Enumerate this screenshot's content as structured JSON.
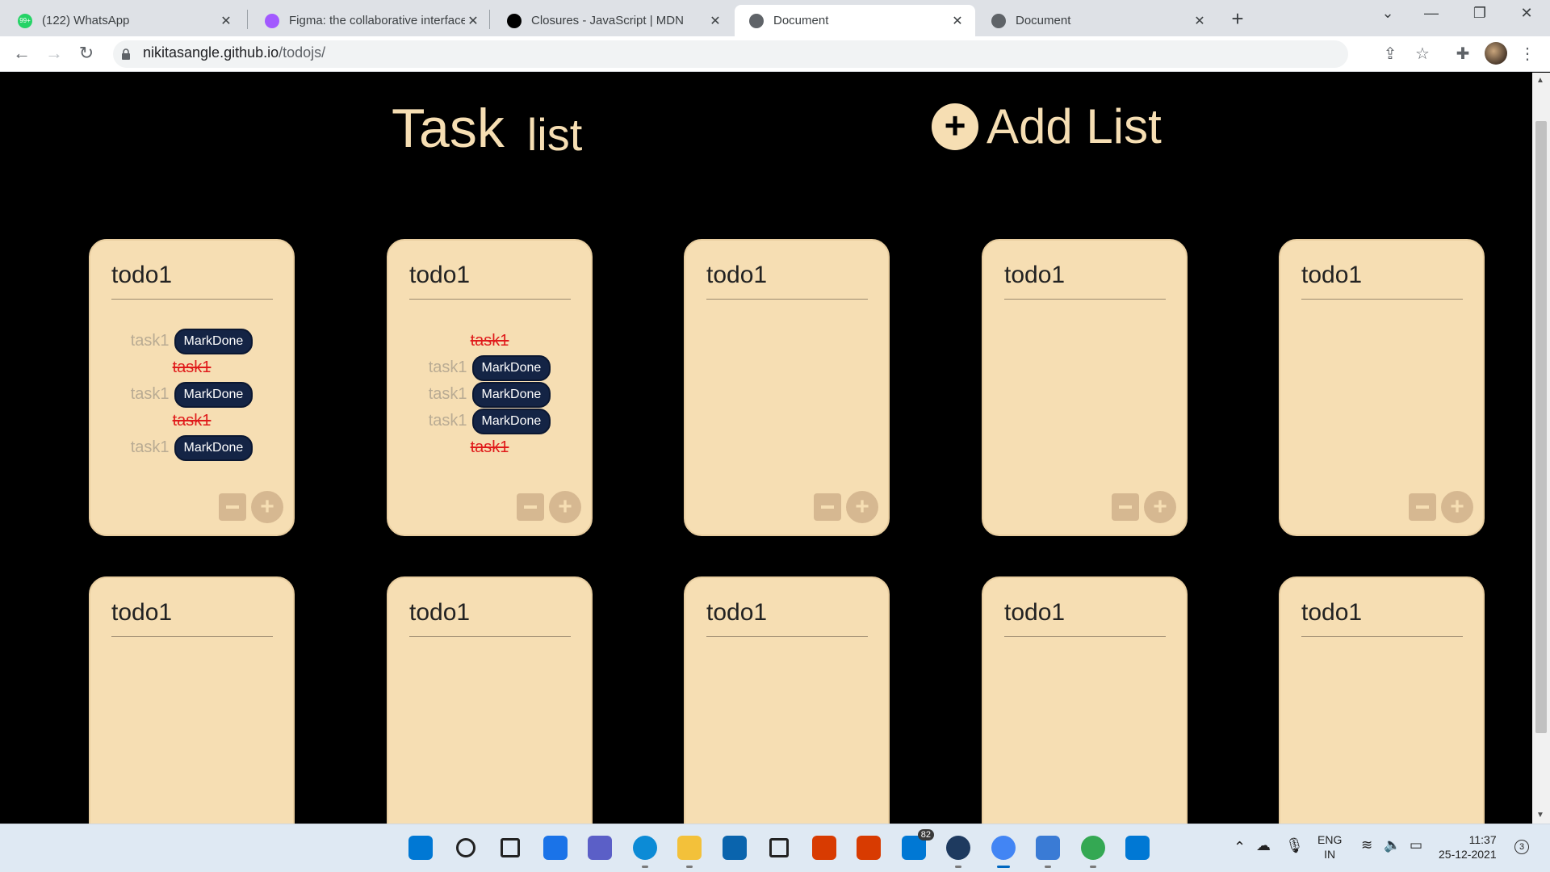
{
  "browser": {
    "tabs": [
      {
        "title": "(122) WhatsApp",
        "icon": "whatsapp-icon",
        "color": "#25d366",
        "badge": "99+"
      },
      {
        "title": "Figma: the collaborative interface",
        "icon": "figma-icon",
        "color": "#a259ff"
      },
      {
        "title": "Closures - JavaScript | MDN",
        "icon": "mdn-icon",
        "color": "#000000"
      },
      {
        "title": "Document",
        "icon": "globe-icon",
        "color": "#5f6368",
        "active": true
      },
      {
        "title": "Document",
        "icon": "globe-icon",
        "color": "#5f6368"
      }
    ],
    "new_tab": "+",
    "url_host": "nikitasangle.github.io",
    "url_path": "/todojs/"
  },
  "page": {
    "heading_word1": "Task",
    "heading_word2": "list",
    "add_list_icon": "+",
    "add_list_label": "Add List",
    "accent_color": "#f6deb3",
    "mark_done_label": "MarkDone",
    "cards": [
      {
        "title": "todo1",
        "tasks": [
          {
            "name": "task1",
            "done": false
          },
          {
            "name": "task1",
            "done": true
          },
          {
            "name": "task1",
            "done": false
          },
          {
            "name": "task1",
            "done": true
          },
          {
            "name": "task1",
            "done": false
          }
        ]
      },
      {
        "title": "todo1",
        "tasks": [
          {
            "name": "task1",
            "done": true
          },
          {
            "name": "task1",
            "done": false
          },
          {
            "name": "task1",
            "done": false
          },
          {
            "name": "task1",
            "done": false
          },
          {
            "name": "task1",
            "done": true
          }
        ]
      },
      {
        "title": "todo1",
        "tasks": []
      },
      {
        "title": "todo1",
        "tasks": []
      },
      {
        "title": "todo1",
        "tasks": []
      },
      {
        "title": "todo1",
        "tasks": []
      },
      {
        "title": "todo1",
        "tasks": []
      },
      {
        "title": "todo1",
        "tasks": []
      },
      {
        "title": "todo1",
        "tasks": []
      },
      {
        "title": "todo1",
        "tasks": []
      }
    ]
  },
  "taskbar": {
    "apps": [
      {
        "name": "start-icon",
        "color": "#0078d4"
      },
      {
        "name": "search-icon",
        "color": "#222222"
      },
      {
        "name": "task-view-icon",
        "color": "#222222"
      },
      {
        "name": "widgets-icon",
        "color": "#1a73e8"
      },
      {
        "name": "chat-icon",
        "color": "#5b5fc7"
      },
      {
        "name": "edge-icon",
        "color": "#0c8bd6"
      },
      {
        "name": "file-explorer-icon",
        "color": "#f3c13a"
      },
      {
        "name": "mail-icon",
        "color": "#0a64ad"
      },
      {
        "name": "dropbox-icon",
        "color": "#222222"
      },
      {
        "name": "office-icon",
        "color": "#d83b01"
      },
      {
        "name": "office-icon-2",
        "color": "#d83b01"
      },
      {
        "name": "store-icon",
        "color": "#0078d4",
        "badge": "82"
      },
      {
        "name": "alexa-icon",
        "color": "#1e3a5f"
      },
      {
        "name": "chrome-icon",
        "color": "#4285f4",
        "active": true
      },
      {
        "name": "notepad-icon",
        "color": "#3a7bd5"
      },
      {
        "name": "chrome-profile-icon",
        "color": "#34a853"
      },
      {
        "name": "vscode-icon",
        "color": "#0078d4"
      }
    ],
    "lang_top": "ENG",
    "lang_bottom": "IN",
    "time": "11:37",
    "date": "25-12-2021",
    "notifications": "3"
  }
}
